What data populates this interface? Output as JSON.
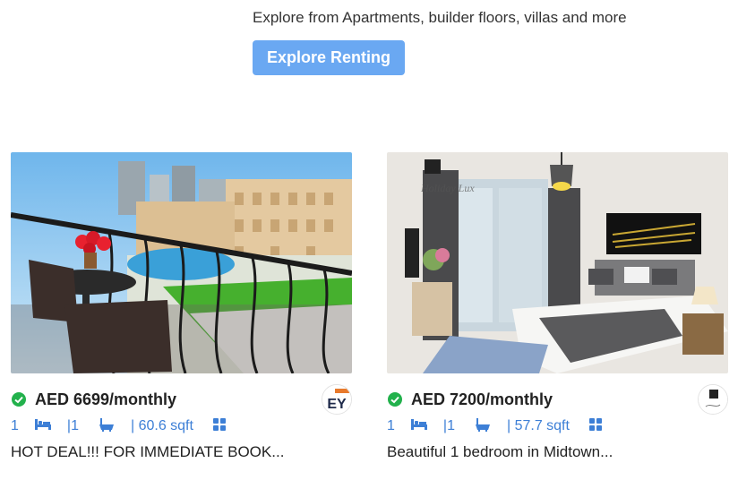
{
  "hero": {
    "text": "Explore from Apartments, builder floors, villas and more",
    "button_label": "Explore Renting"
  },
  "listings": [
    {
      "price": "AED 6699/monthly",
      "bedrooms": "1",
      "bathrooms": "|1",
      "area": "| 60.6 sqft",
      "title": "HOT DEAL!!! FOR IMMEDIATE BOOK...",
      "agency_logo_text": "EY"
    },
    {
      "price": "AED 7200/monthly",
      "bedrooms": "1",
      "bathrooms": "|1",
      "area": "| 57.7 sqft",
      "title": "Beautiful 1 bedroom in Midtown..."
    }
  ],
  "colors": {
    "accent": "#3d7fd6",
    "button": "#6aa8f2",
    "verified": "#22b14c"
  },
  "icons": [
    "check-verified-icon",
    "bed-icon",
    "bath-icon",
    "grid-icon"
  ]
}
